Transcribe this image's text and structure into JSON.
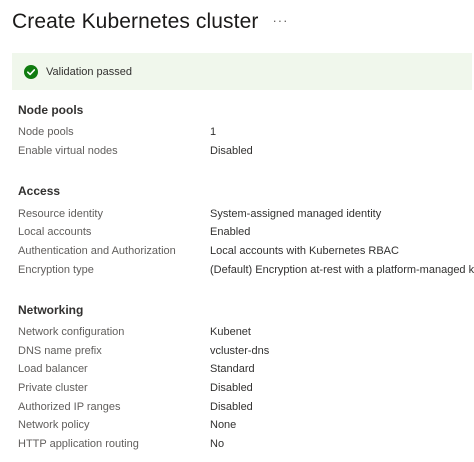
{
  "header": {
    "title": "Create Kubernetes cluster",
    "more_label": "···"
  },
  "banner": {
    "message": "Validation passed",
    "status_color": "#107c10",
    "icon": "check-circle-icon"
  },
  "sections": {
    "node_pools": {
      "heading": "Node pools",
      "rows": [
        {
          "key": "Node pools",
          "value": "1"
        },
        {
          "key": "Enable virtual nodes",
          "value": "Disabled"
        }
      ]
    },
    "access": {
      "heading": "Access",
      "rows": [
        {
          "key": "Resource identity",
          "value": "System-assigned managed identity"
        },
        {
          "key": "Local accounts",
          "value": "Enabled"
        },
        {
          "key": "Authentication and Authorization",
          "value": "Local accounts with Kubernetes RBAC"
        },
        {
          "key": "Encryption type",
          "value": "(Default) Encryption at-rest with a platform-managed key"
        }
      ]
    },
    "networking": {
      "heading": "Networking",
      "rows": [
        {
          "key": "Network configuration",
          "value": "Kubenet"
        },
        {
          "key": "DNS name prefix",
          "value": "vcluster-dns"
        },
        {
          "key": "Load balancer",
          "value": "Standard"
        },
        {
          "key": "Private cluster",
          "value": "Disabled"
        },
        {
          "key": "Authorized IP ranges",
          "value": "Disabled"
        },
        {
          "key": "Network policy",
          "value": "None"
        },
        {
          "key": "HTTP application routing",
          "value": "No"
        }
      ]
    }
  }
}
